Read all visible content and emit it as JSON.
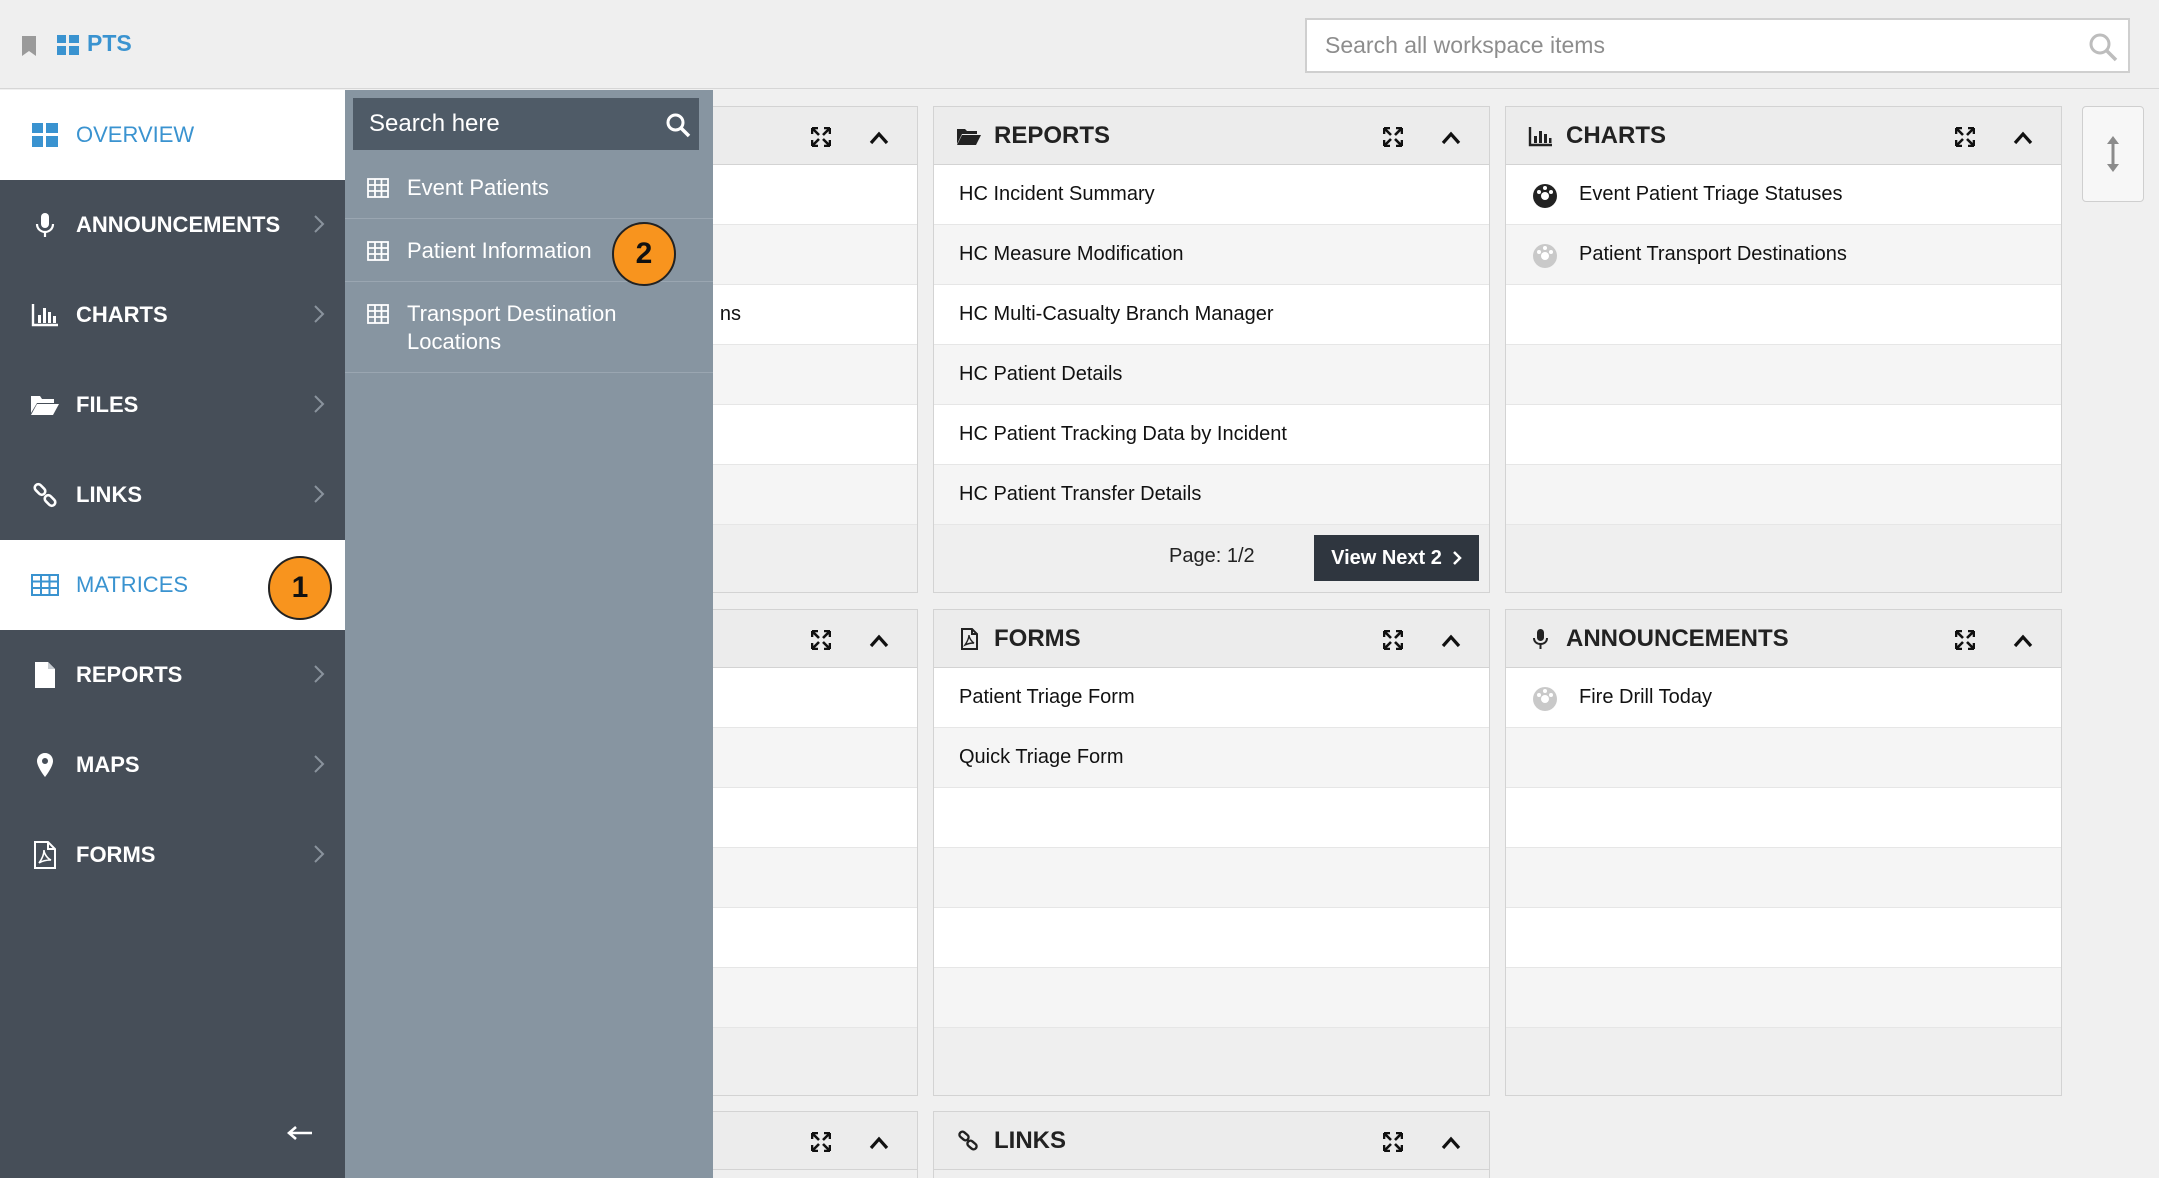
{
  "header": {
    "brand": "PTS",
    "search_placeholder": "Search all workspace items"
  },
  "sidebar": {
    "items": [
      {
        "label": "OVERVIEW",
        "icon": "grid-icon"
      },
      {
        "label": "ANNOUNCEMENTS",
        "icon": "microphone-icon"
      },
      {
        "label": "CHARTS",
        "icon": "bar-chart-icon"
      },
      {
        "label": "FILES",
        "icon": "folder-open-icon"
      },
      {
        "label": "LINKS",
        "icon": "link-icon"
      },
      {
        "label": "MATRICES",
        "icon": "table-icon"
      },
      {
        "label": "REPORTS",
        "icon": "document-icon"
      },
      {
        "label": "MAPS",
        "icon": "map-pin-icon"
      },
      {
        "label": "FORMS",
        "icon": "pdf-form-icon"
      }
    ],
    "active": "MATRICES"
  },
  "flyout": {
    "search_placeholder": "Search here",
    "items": [
      {
        "label": "Event Patients"
      },
      {
        "label": "Patient Information"
      },
      {
        "label": "Transport Destination Locations"
      }
    ]
  },
  "badges": {
    "one": "1",
    "two": "2"
  },
  "panels": {
    "left_partial": {
      "visible_text": "ns"
    },
    "reports": {
      "title": "REPORTS",
      "rows": [
        "HC Incident Summary",
        "HC Measure Modification",
        "HC Multi-Casualty Branch Manager",
        "HC Patient Details",
        "HC Patient Tracking Data by Incident",
        "HC Patient Transfer Details"
      ],
      "pager": "Page: 1/2",
      "view_next": "View Next 2"
    },
    "charts": {
      "title": "CHARTS",
      "rows": [
        "Event Patient Triage Statuses",
        "Patient Transport Destinations"
      ]
    },
    "forms": {
      "title": "FORMS",
      "rows": [
        "Patient Triage Form",
        "Quick Triage Form"
      ]
    },
    "announcements": {
      "title": "ANNOUNCEMENTS",
      "rows": [
        "Fire Drill Today"
      ]
    },
    "links": {
      "title": "LINKS"
    }
  },
  "colors": {
    "accent": "#3a93d0",
    "sidebar_bg": "#464e58",
    "flyout_bg": "#8795a1",
    "badge": "#f8941e"
  }
}
